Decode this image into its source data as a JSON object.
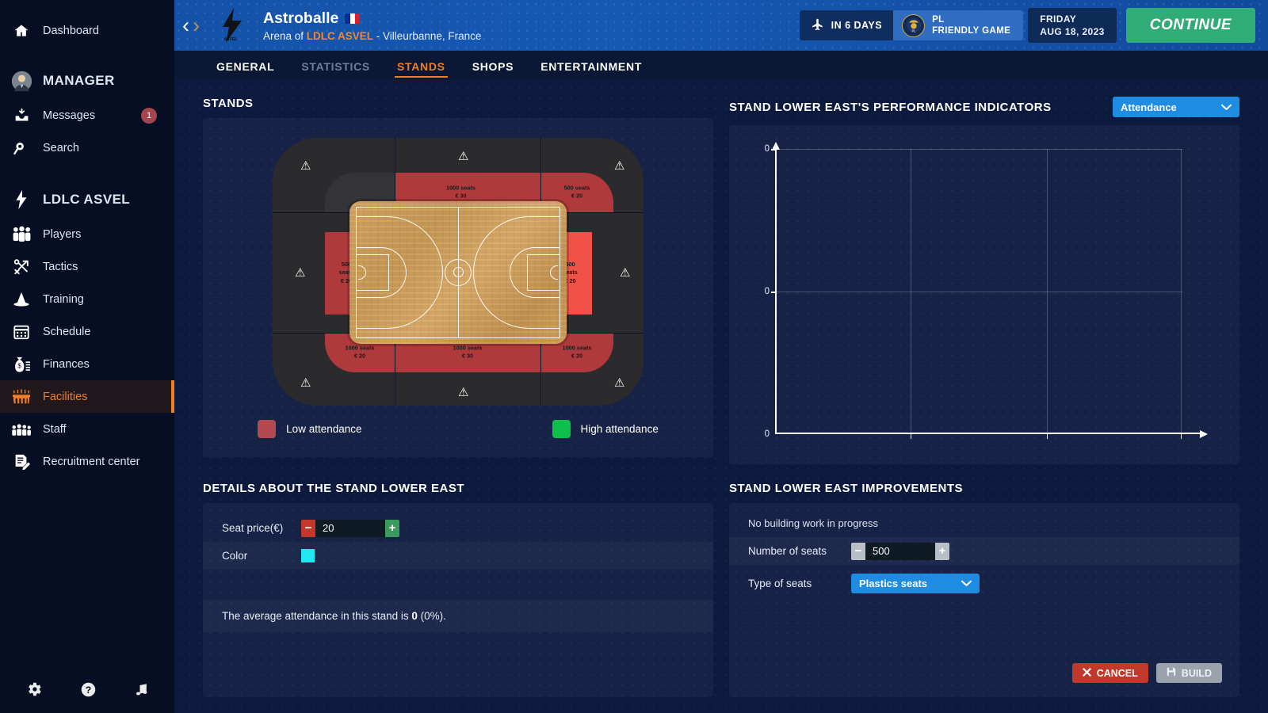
{
  "sidebar": {
    "top": [
      {
        "label": "Dashboard",
        "icon": "home-icon"
      }
    ],
    "manager": {
      "label": "MANAGER",
      "icon": "avatar"
    },
    "personal": [
      {
        "label": "Messages",
        "icon": "inbox-icon",
        "badge": "1"
      },
      {
        "label": "Search",
        "icon": "search-icon"
      }
    ],
    "club": {
      "label": "LDLC ASVEL",
      "icon": "club-crest-icon"
    },
    "items": [
      {
        "label": "Players",
        "icon": "players-icon"
      },
      {
        "label": "Tactics",
        "icon": "tactics-icon"
      },
      {
        "label": "Training",
        "icon": "cone-icon"
      },
      {
        "label": "Schedule",
        "icon": "calendar-icon"
      },
      {
        "label": "Finances",
        "icon": "money-bag-icon"
      },
      {
        "label": "Facilities",
        "icon": "stadium-icon",
        "active": true
      },
      {
        "label": "Staff",
        "icon": "staff-icon"
      },
      {
        "label": "Recruitment center",
        "icon": "recruitment-icon"
      }
    ],
    "bottom": [
      {
        "icon": "settings-gear-icon"
      },
      {
        "icon": "help-question-icon"
      },
      {
        "icon": "music-note-icon"
      }
    ]
  },
  "header": {
    "prev_arrow": "‹",
    "next_arrow": "›",
    "venue_name": "Astroballe",
    "venue_subtitle_prefix": "Arena of ",
    "venue_club": "LDLC ASVEL",
    "venue_subtitle_suffix": " - Villeurbanne, France",
    "countdown": "IN 6 DAYS",
    "competition_short": "PL",
    "competition_name": "FRIENDLY GAME",
    "date_day": "FRIDAY",
    "date_full": "AUG 18, 2023",
    "continue_label": "CONTINUE"
  },
  "tabs": [
    {
      "label": "GENERAL",
      "state": "normal"
    },
    {
      "label": "STATISTICS",
      "state": "dim"
    },
    {
      "label": "STANDS",
      "state": "selected"
    },
    {
      "label": "SHOPS",
      "state": "normal"
    },
    {
      "label": "ENTERTAINMENT",
      "state": "normal"
    }
  ],
  "stands_panel": {
    "title": "STANDS",
    "legend": [
      {
        "label": "Low attendance",
        "color": "#b44a4f"
      },
      {
        "label": "High attendance",
        "color": "#0ec04a"
      }
    ],
    "segments": [
      {
        "id": "nw-corner",
        "seats": "",
        "price": "",
        "state": "empty"
      },
      {
        "id": "north",
        "seats": "1000 seats",
        "price": "€ 30",
        "state": "low"
      },
      {
        "id": "ne-corner",
        "seats": "500 seats",
        "price": "€ 20",
        "state": "low"
      },
      {
        "id": "west",
        "seats": "500 seats",
        "price": "€ 20",
        "state": "low"
      },
      {
        "id": "east",
        "seats": "500 seats",
        "price": "€ 20",
        "state": "selected"
      },
      {
        "id": "sw-corner",
        "seats": "1000 seats",
        "price": "€ 20",
        "state": "low"
      },
      {
        "id": "south",
        "seats": "1000 seats",
        "price": "€ 30",
        "state": "low"
      },
      {
        "id": "se-corner",
        "seats": "1000 seats",
        "price": "€ 20",
        "state": "low"
      }
    ],
    "warning_icon": "warning-triangle-icon"
  },
  "performance_panel": {
    "title": "STAND LOWER EAST'S PERFORMANCE INDICATORS",
    "metric_selected": "Attendance",
    "dropdown_icon": "chevron-down-icon"
  },
  "chart_data": {
    "type": "line",
    "title": "Attendance",
    "series": [
      {
        "name": "Attendance",
        "values": []
      }
    ],
    "x": [],
    "xlabel": "",
    "ylabel": "",
    "ytick_labels": [
      "0",
      "0",
      "0"
    ],
    "xtick_labels": [
      "",
      "",
      "",
      ""
    ],
    "ylim": [
      0,
      0
    ],
    "grid": true,
    "legend": "none",
    "note": "empty plot, no data points rendered"
  },
  "details_panel": {
    "title": "DETAILS ABOUT THE STAND LOWER EAST",
    "rows": [
      {
        "label": "Seat price(€)",
        "value": "20",
        "type": "stepper"
      },
      {
        "label": "Color",
        "value": "#22e6f0",
        "type": "color"
      }
    ],
    "summary_prefix": "The average attendance in this stand is ",
    "summary_value": "0",
    "summary_suffix": " (0%)."
  },
  "improvements_panel": {
    "title": "STAND LOWER EAST IMPROVEMENTS",
    "status": "No building work in progress",
    "seats_label": "Number of seats",
    "seats_value": "500",
    "type_label": "Type of seats",
    "type_value": "Plastics seats",
    "cancel_label": "CANCEL",
    "build_label": "BUILD",
    "cancel_icon": "close-x-icon",
    "build_icon": "save-disk-icon"
  }
}
